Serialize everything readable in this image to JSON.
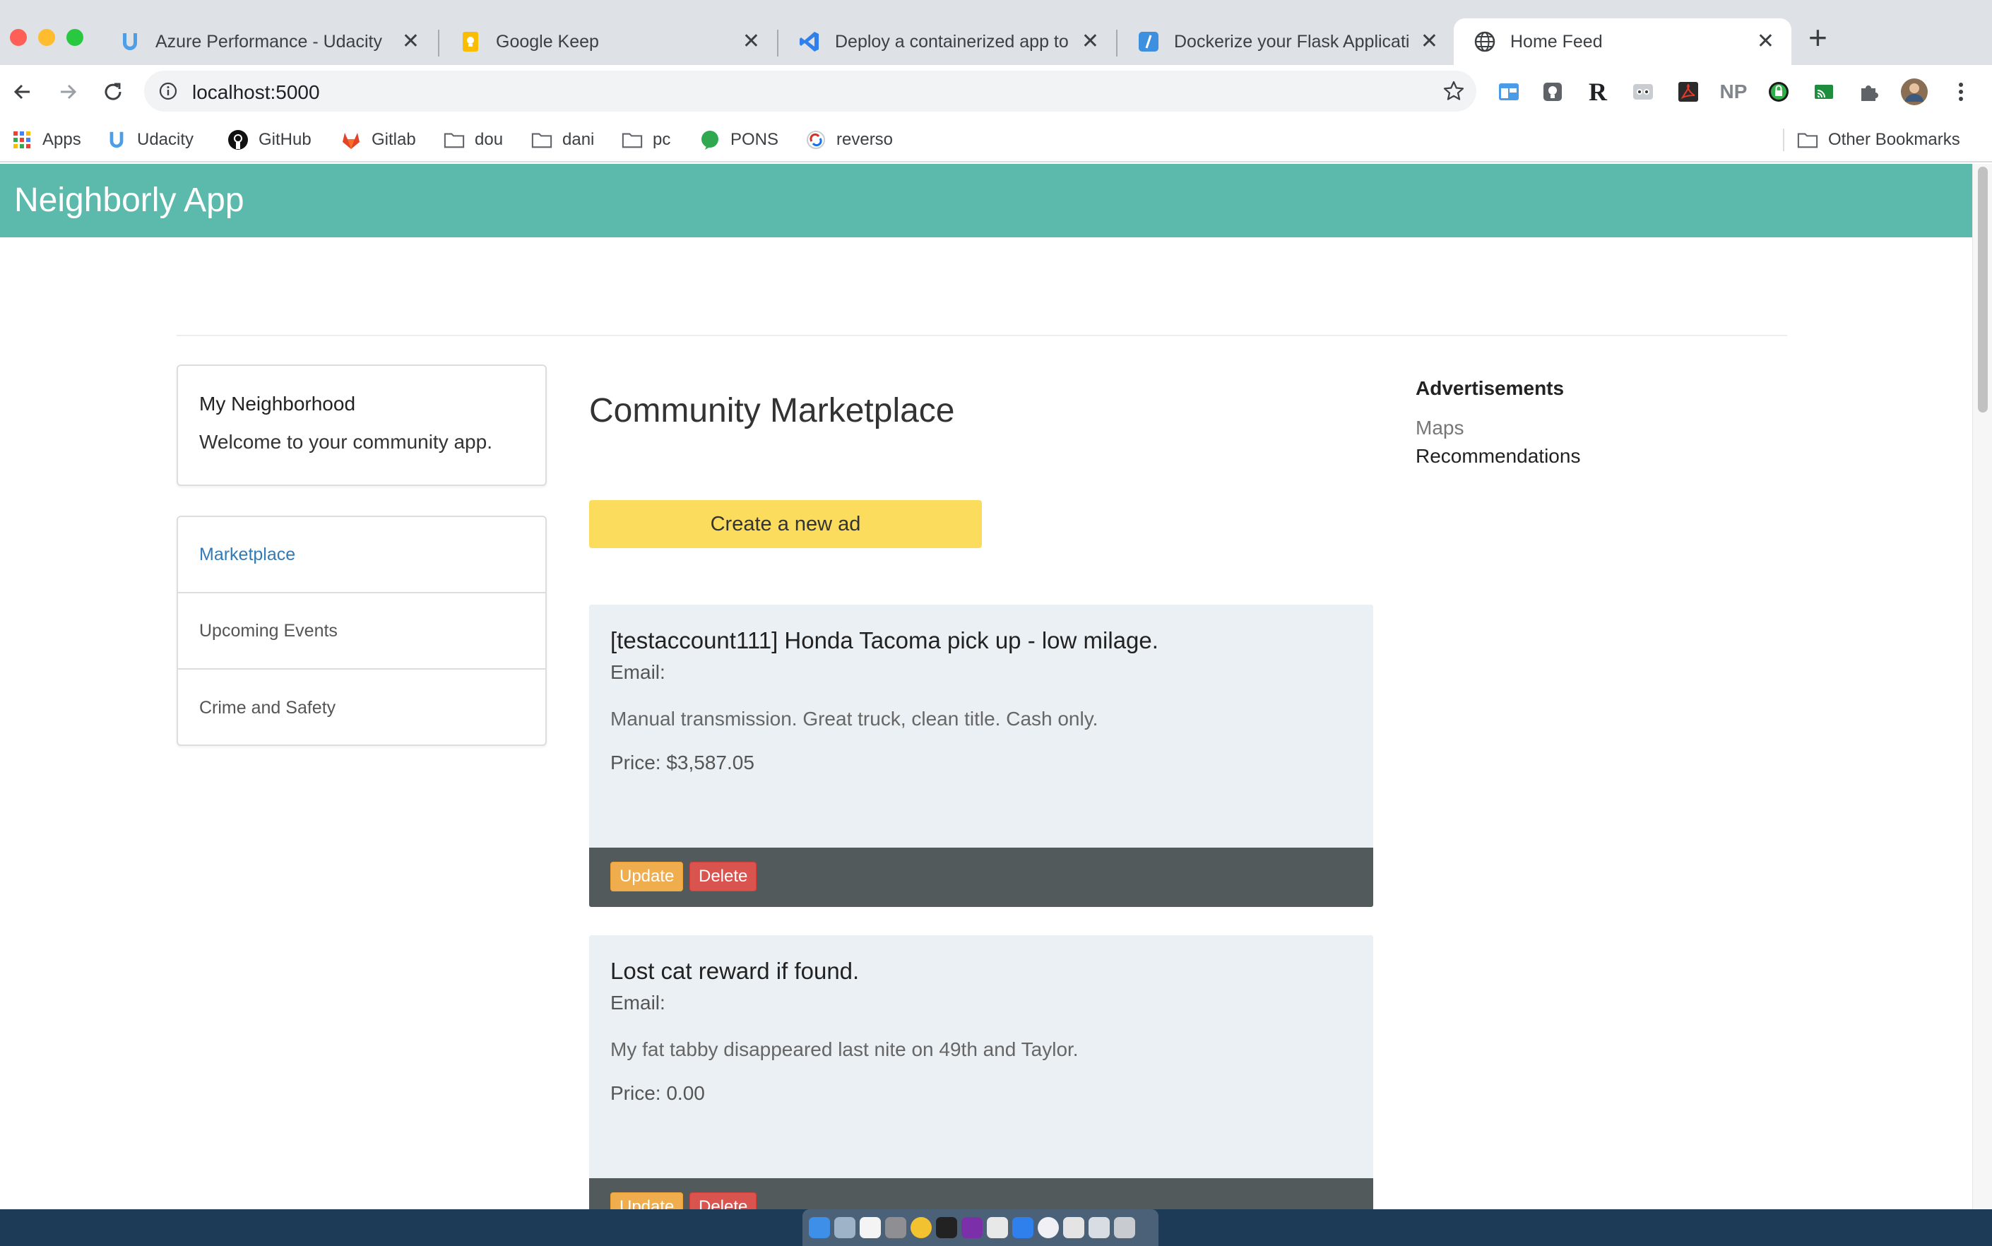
{
  "browser": {
    "tabs": [
      {
        "title": "Azure Performance - Udacity",
        "icon": "udacity-icon",
        "active": false
      },
      {
        "title": "Google Keep",
        "icon": "google-keep-icon",
        "active": false
      },
      {
        "title": "Deploy a containerized app to Azure",
        "icon": "vscode-icon",
        "active": false
      },
      {
        "title": "Dockerize your Flask Application",
        "icon": "slash-icon",
        "active": false
      },
      {
        "title": "Home Feed",
        "icon": "globe-icon",
        "active": true
      }
    ],
    "new_tab": "+",
    "close_glyph": "✕",
    "url": "localhost:5000",
    "bookmarks": [
      {
        "label": "Apps",
        "icon": "apps-grid-icon"
      },
      {
        "label": "Udacity",
        "icon": "udacity-icon"
      },
      {
        "label": "GitHub",
        "icon": "github-icon"
      },
      {
        "label": "Gitlab",
        "icon": "gitlab-icon"
      },
      {
        "label": "dou",
        "icon": "folder-icon"
      },
      {
        "label": "dani",
        "icon": "folder-icon"
      },
      {
        "label": "pc",
        "icon": "folder-icon"
      },
      {
        "label": "PONS",
        "icon": "pons-icon"
      },
      {
        "label": "reverso",
        "icon": "reverso-icon"
      }
    ],
    "other_bookmarks": "Other Bookmarks",
    "extensions": [
      "R",
      "NP"
    ]
  },
  "app": {
    "brand": "Neighborly App",
    "neighborhood": {
      "title": "My Neighborhood",
      "welcome": "Welcome to your community app."
    },
    "nav": [
      {
        "label": "Marketplace",
        "active": true
      },
      {
        "label": "Upcoming Events",
        "active": false
      },
      {
        "label": "Crime and Safety",
        "active": false
      }
    ],
    "heading": "Community Marketplace",
    "create_button": "Create a new ad",
    "ads": [
      {
        "title": "[testaccount111] Honda Tacoma pick up - low milage.",
        "email": "Email:",
        "description": "Manual transmission. Great truck, clean title. Cash only.",
        "price": "Price: $3,587.05"
      },
      {
        "title": "Lost cat reward if found.",
        "email": "Email:",
        "description": "My fat tabby disappeared last nite on 49th and Taylor.",
        "price": "Price: 0.00"
      }
    ],
    "update_label": "Update",
    "delete_label": "Delete",
    "sidebar_right": {
      "heading": "Advertisements",
      "links": [
        "Maps",
        "Recommendations"
      ]
    }
  },
  "colors": {
    "navbar": "#5bbaac",
    "create_button": "#fcdc5d",
    "link_active": "#337ab7",
    "update": "#f0ad4e",
    "delete": "#d9534f"
  }
}
